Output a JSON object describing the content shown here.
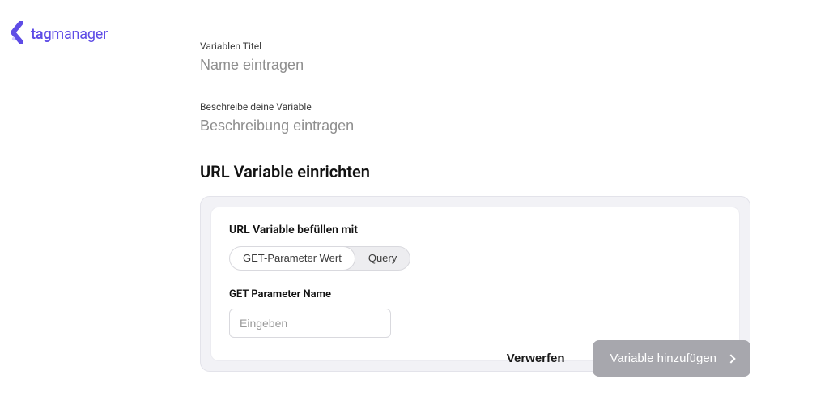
{
  "brand": {
    "name_bold": "tag",
    "name_thin": "manager"
  },
  "fields": {
    "title_label": "Variablen Titel",
    "title_placeholder": "Name eintragen",
    "desc_label": "Beschreibe deine Variable",
    "desc_placeholder": "Beschreibung eintragen"
  },
  "section": {
    "heading": "URL Variable einrichten"
  },
  "config": {
    "fill_label": "URL Variable befüllen mit",
    "pill_active": "GET-Parameter Wert",
    "pill_inactive": "Query",
    "param_label": "GET Parameter Name",
    "param_placeholder": "Eingeben"
  },
  "footer": {
    "discard": "Verwerfen",
    "submit": "Variable hinzufügen"
  }
}
